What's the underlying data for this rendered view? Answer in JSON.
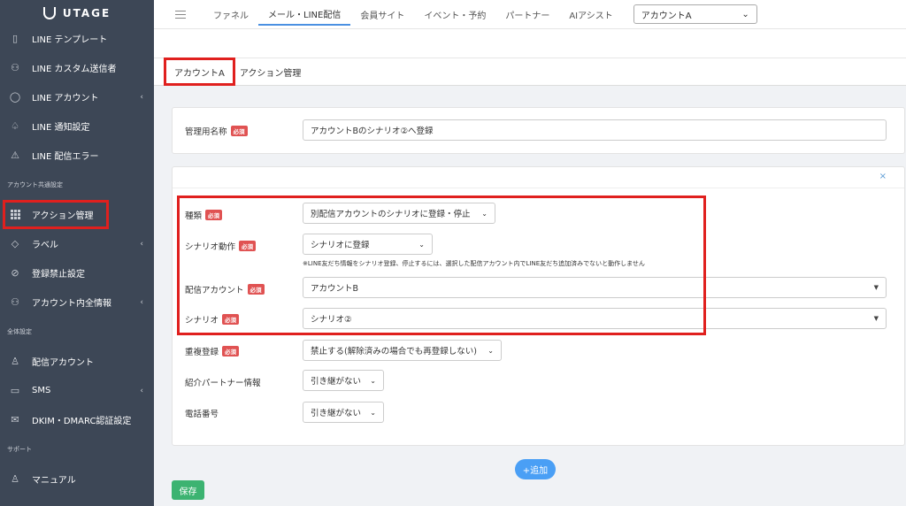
{
  "app": {
    "logo": "UTAGE"
  },
  "sidebar": {
    "items_top": [
      {
        "label": "LINE テンプレート",
        "icon": "document-icon"
      },
      {
        "label": "LINE カスタム送信者",
        "icon": "users-icon"
      },
      {
        "label": "LINE アカウント",
        "icon": "chat-icon",
        "chevron": "‹"
      },
      {
        "label": "LINE 通知設定",
        "icon": "bell-icon"
      },
      {
        "label": "LINE 配信エラー",
        "icon": "warning-icon"
      }
    ],
    "section1": "アカウント共通設定",
    "items_mid": [
      {
        "label": "アクション管理",
        "icon": "grid-icon"
      },
      {
        "label": "ラベル",
        "icon": "tag-icon",
        "chevron": "‹"
      },
      {
        "label": "登録禁止設定",
        "icon": "ban-icon"
      },
      {
        "label": "アカウント内全情報",
        "icon": "users-icon",
        "chevron": "‹"
      }
    ],
    "section2": "全体設定",
    "items_bottom": [
      {
        "label": "配信アカウント",
        "icon": "user-icon"
      },
      {
        "label": "SMS",
        "icon": "sms-icon",
        "chevron": "‹"
      },
      {
        "label": "DKIM・DMARC認証設定",
        "icon": "mail-icon"
      }
    ],
    "section3": "サポート",
    "items_support": [
      {
        "label": "マニュアル",
        "icon": "book-icon"
      }
    ]
  },
  "topbar": {
    "tabs": [
      "ファネル",
      "メール・LINE配信",
      "会員サイト",
      "イベント・予約",
      "パートナー",
      "AIアシスト"
    ],
    "account_select": "アカウントA"
  },
  "subtabs": [
    "アカウントA",
    "アクション管理"
  ],
  "form": {
    "management_name_label": "管理用名称",
    "management_name_value": "アカウントBのシナリオ②へ登録",
    "required": "必須",
    "type_label": "種類",
    "type_value": "別配信アカウントのシナリオに登録・停止",
    "scenario_action_label": "シナリオ動作",
    "scenario_action_value": "シナリオに登録",
    "note": "※LINE友だち情報をシナリオ登録、停止するには、選択した配信アカウント内でLINE友だち追加済みでないと動作しません",
    "delivery_account_label": "配信アカウント",
    "delivery_account_value": "アカウントB",
    "scenario_label": "シナリオ",
    "scenario_value": "シナリオ②",
    "duplicate_label": "重複登録",
    "duplicate_value": "禁止する(解除済みの場合でも再登録しない)",
    "partner_label": "紹介パートナー情報",
    "partner_value": "引き継がない",
    "phone_label": "電話番号",
    "phone_value": "引き継がない",
    "close": "×"
  },
  "buttons": {
    "add": "+追加",
    "save": "保存"
  }
}
